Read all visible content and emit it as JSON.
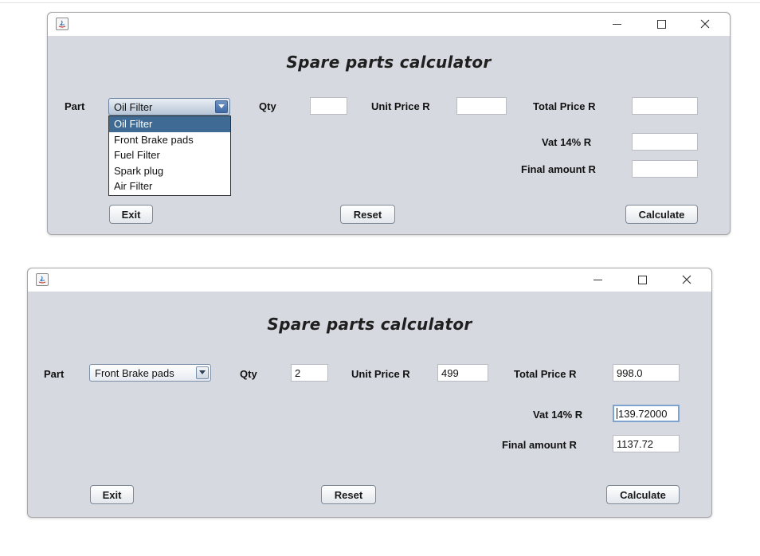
{
  "window1": {
    "app_title": "Spare parts calculator",
    "labels": {
      "part": "Part",
      "qty": "Qty",
      "unit_price": "Unit Price  R",
      "total_price": "Total Price  R",
      "vat": "Vat 14%  R",
      "final_amount": "Final amount  R"
    },
    "part_select": {
      "value": "Oil Filter",
      "expanded": true,
      "options": [
        "Oil Filter",
        "Front Brake pads",
        "Fuel Filter",
        "Spark plug",
        "Air Filter"
      ],
      "selected_option": "Oil Filter"
    },
    "fields": {
      "qty": "",
      "unit_price": "",
      "total_price": "",
      "vat": "",
      "final_amount": ""
    },
    "buttons": {
      "exit": "Exit",
      "reset": "Reset",
      "calculate": "Calculate"
    }
  },
  "window2": {
    "app_title": "Spare parts calculator",
    "labels": {
      "part": "Part",
      "qty": "Qty",
      "unit_price": "Unit Price  R",
      "total_price": "Total Price  R",
      "vat": "Vat 14%  R",
      "final_amount": "Final amount  R"
    },
    "part_select": {
      "value": "Front Brake pads",
      "expanded": false
    },
    "fields": {
      "qty": "2",
      "unit_price": "499",
      "total_price": "998.0",
      "vat": "139.72000",
      "final_amount": "1137.72"
    },
    "buttons": {
      "exit": "Exit",
      "reset": "Reset",
      "calculate": "Calculate"
    }
  },
  "icons": {
    "app": "java-app-icon",
    "minimize": "minimize-icon",
    "maximize": "maximize-icon",
    "close": "close-icon",
    "dropdown_arrow": "triangle-down-icon"
  },
  "colors": {
    "window_body": "#d6d9df",
    "title_bar": "#ffffff",
    "dropdown_selected": "#3e6a93",
    "focus_border": "#7fa3cf"
  }
}
